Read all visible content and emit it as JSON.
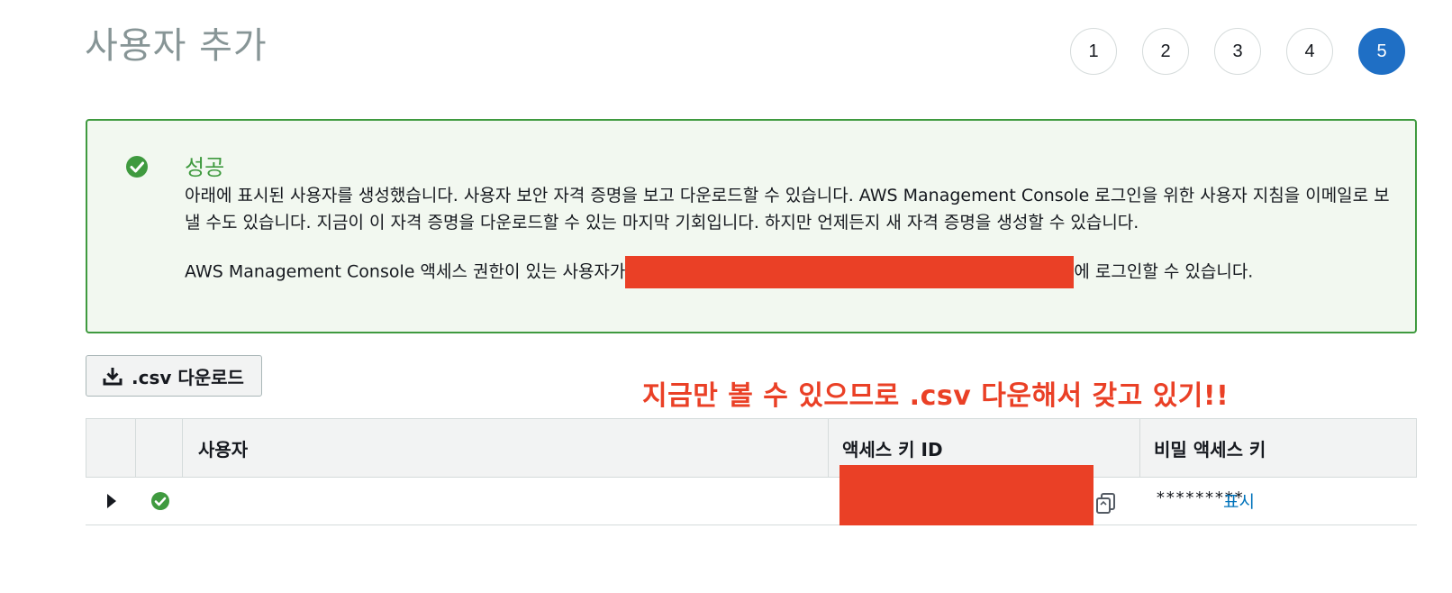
{
  "page": {
    "title": "사용자 추가"
  },
  "steps": [
    "1",
    "2",
    "3",
    "4",
    "5"
  ],
  "active_step": "5",
  "alert": {
    "title": "성공",
    "body": "아래에 표시된 사용자를 생성했습니다. 사용자 보안 자격 증명을 보고 다운로드할 수 있습니다. AWS Management Console 로그인을 위한 사용자 지침을 이메일로 보낼 수도 있습니다. 지금이 이 자격 증명을 다운로드할 수 있는 마지막 기회입니다. 하지만 언제든지 새 자격 증명을 생성할 수 있습니다.",
    "login_prefix": "AWS Management Console 액세스 권한이 있는 사용자가",
    "login_suffix": "에 로그인할 수 있습니다."
  },
  "toolbar": {
    "csv_label": ".csv 다운로드"
  },
  "annotation": "지금만 볼 수 있으므로 .csv 다운해서 갖고 있기!!",
  "table": {
    "headers": [
      "사용자",
      "액세스 키 ID",
      "비밀 액세스 키"
    ],
    "rows": [
      {
        "user": "",
        "secret_mask": "*********",
        "show_label": "표시"
      }
    ]
  },
  "colors": {
    "success": "#3f9a3f",
    "accent": "#1f6fc5",
    "redaction": "#ea4026",
    "link": "#0073bb"
  },
  "icons": [
    "check-circle-icon",
    "download-icon",
    "caret-right-icon",
    "copy-icon"
  ]
}
